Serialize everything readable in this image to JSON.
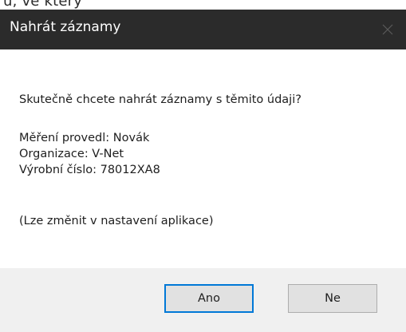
{
  "top_fragment": "u, ve který",
  "dialog": {
    "title": "Nahrát záznamy",
    "question": "Skutečně chcete nahrát záznamy s těmito údaji?",
    "details": [
      "Měření provedl: Novák",
      "Organizace: V-Net",
      "Výrobní číslo: 78012XA8"
    ],
    "note": "(Lze změnit v nastavení aplikace)",
    "buttons": {
      "yes": "Ano",
      "no": "Ne"
    },
    "icons": {
      "close": "close-icon"
    }
  },
  "colors": {
    "titlebar": "#2b2b2b",
    "footer": "#f0f0f0",
    "focus_border": "#0078d7"
  }
}
